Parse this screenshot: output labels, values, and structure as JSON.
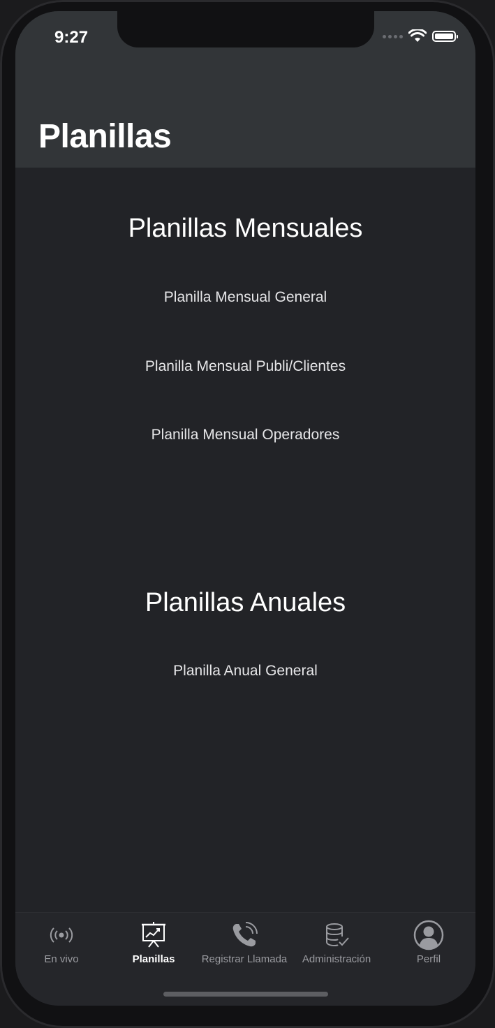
{
  "status_bar": {
    "time": "9:27"
  },
  "header": {
    "title": "Planillas"
  },
  "sections": {
    "monthly": {
      "title": "Planillas Mensuales",
      "items": [
        "Planilla Mensual General",
        "Planilla Mensual Publi/Clientes",
        "Planilla Mensual Operadores"
      ]
    },
    "annual": {
      "title": "Planillas Anuales",
      "items": [
        "Planilla Anual General"
      ]
    }
  },
  "tab_bar": {
    "tabs": [
      {
        "label": "En vivo",
        "icon": "broadcast-icon",
        "active": false
      },
      {
        "label": "Planillas",
        "icon": "presentation-chart-icon",
        "active": true
      },
      {
        "label": "Registrar Llamada",
        "icon": "phone-call-icon",
        "active": false
      },
      {
        "label": "Administración",
        "icon": "database-check-icon",
        "active": false
      },
      {
        "label": "Perfil",
        "icon": "user-circle-icon",
        "active": false
      }
    ]
  },
  "colors": {
    "background": "#222327",
    "header": "#323538",
    "tab_inactive": "#9a9ba0",
    "tab_active": "#ffffff"
  }
}
